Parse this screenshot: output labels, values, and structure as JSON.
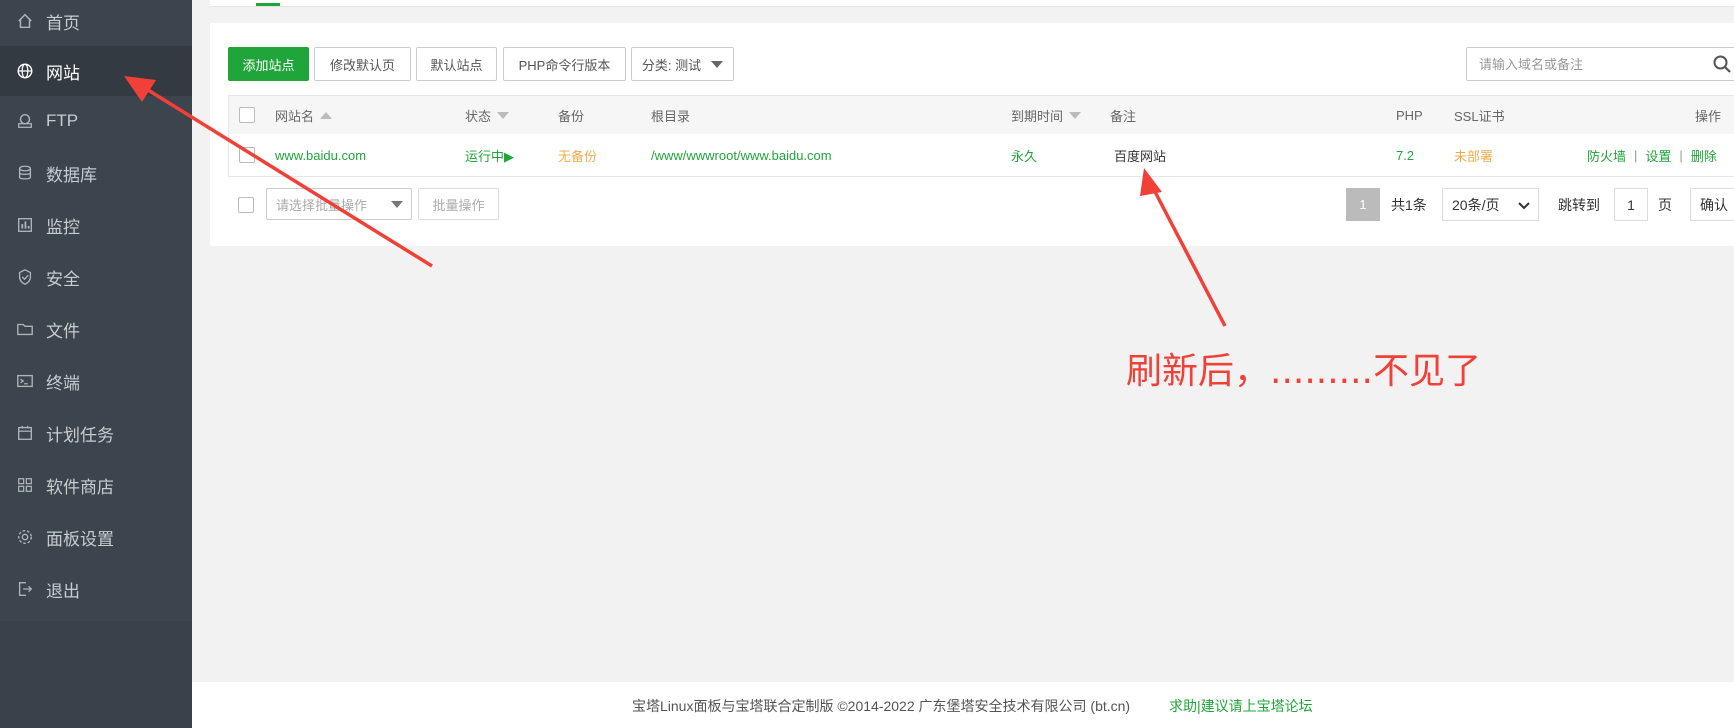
{
  "sidebar": {
    "items": [
      {
        "label": "首页",
        "icon": "home-icon"
      },
      {
        "label": "网站",
        "icon": "globe-icon",
        "active": true
      },
      {
        "label": "FTP",
        "icon": "ftp-icon"
      },
      {
        "label": "数据库",
        "icon": "database-icon"
      },
      {
        "label": "监控",
        "icon": "monitor-icon"
      },
      {
        "label": "安全",
        "icon": "shield-icon"
      },
      {
        "label": "文件",
        "icon": "folder-icon"
      },
      {
        "label": "终端",
        "icon": "terminal-icon"
      },
      {
        "label": "计划任务",
        "icon": "calendar-icon"
      },
      {
        "label": "软件商店",
        "icon": "apps-icon"
      },
      {
        "label": "面板设置",
        "icon": "gear-icon"
      },
      {
        "label": "退出",
        "icon": "logout-icon"
      }
    ]
  },
  "toolbar": {
    "add_site": "添加站点",
    "edit_default_page": "修改默认页",
    "default_site": "默认站点",
    "php_cli_version": "PHP命令行版本",
    "category": "分类: 测试",
    "search_placeholder": "请输入域名或备注"
  },
  "table": {
    "headers": {
      "name": "网站名",
      "status": "状态",
      "backup": "备份",
      "root": "根目录",
      "expire": "到期时间",
      "note": "备注",
      "php": "PHP",
      "ssl": "SSL证书",
      "actions": "操作"
    },
    "rows": [
      {
        "name": "www.baidu.com",
        "status": "运行中▶",
        "backup": "无备份",
        "root": "/www/wwwroot/www.baidu.com",
        "expire": "永久",
        "note": "百度网站",
        "php": "7.2",
        "ssl": "未部署",
        "action_firewall": "防火墙",
        "action_settings": "设置",
        "action_delete": "删除",
        "separator": "|"
      }
    ]
  },
  "batch": {
    "select_placeholder": "请选择批量操作",
    "button": "批量操作"
  },
  "pagination": {
    "current": "1",
    "total": "共1条",
    "per_page": "20条/页",
    "jump_label": "跳转到",
    "jump_value": "1",
    "page_unit": "页",
    "confirm": "确认"
  },
  "footer": {
    "copyright": "宝塔Linux面板与宝塔联合定制版 ©2014-2022 广东堡塔安全技术有限公司 (bt.cn)",
    "help_link": "求助|建议请上宝塔论坛"
  },
  "annotation": {
    "text": "刷新后，.........不见了",
    "color": "#f04038"
  },
  "colors": {
    "accent": "#20a53a",
    "sidebar_bg": "#3c444d",
    "warning": "#f0ad4e"
  }
}
